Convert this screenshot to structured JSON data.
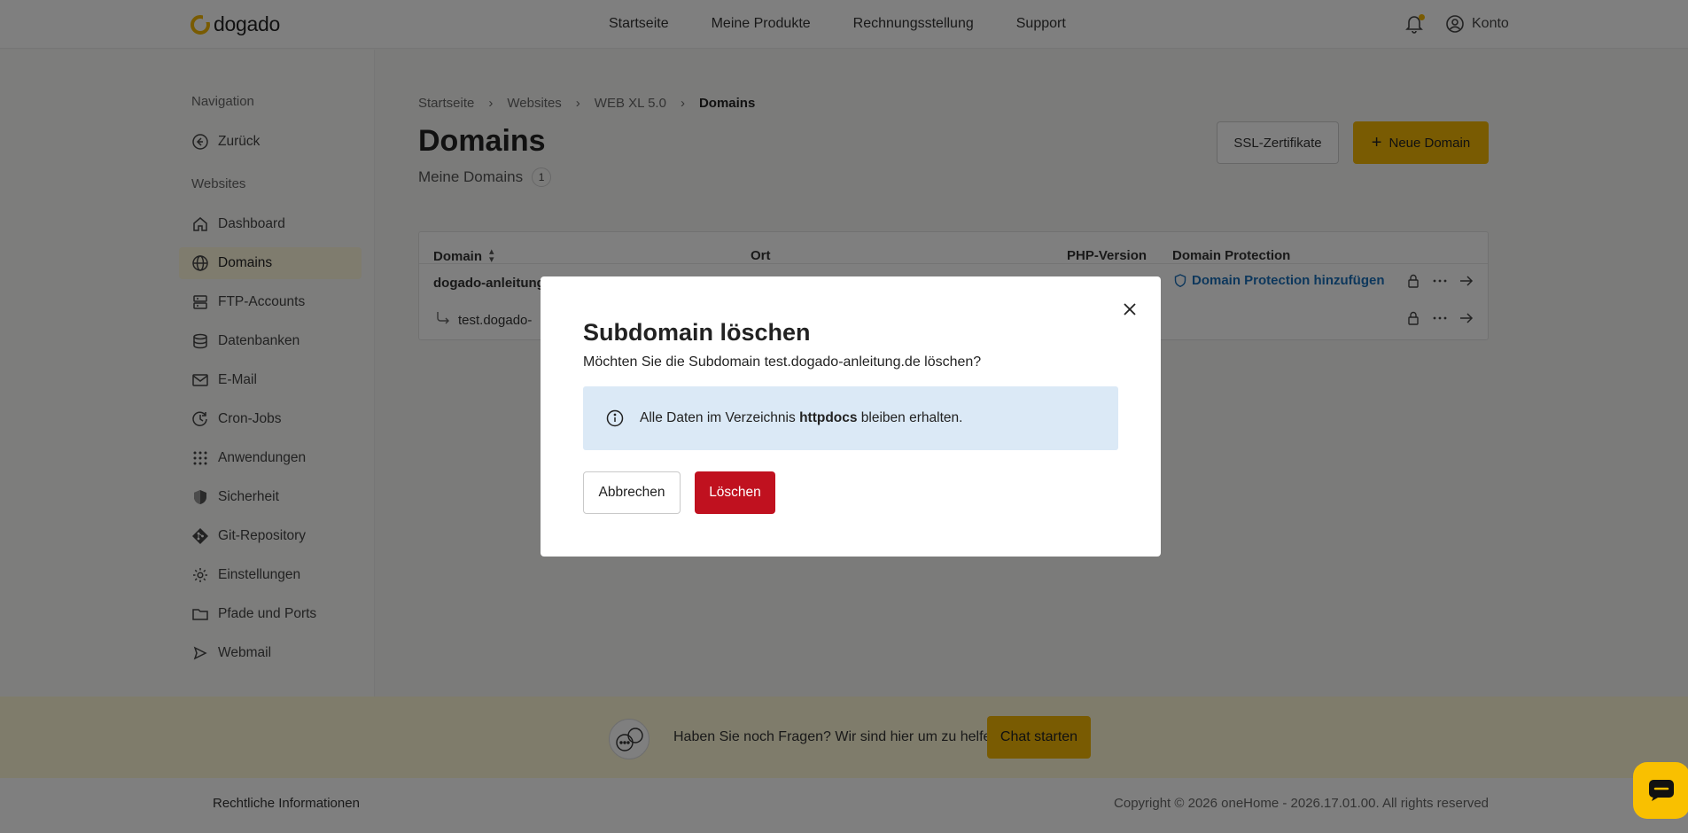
{
  "header": {
    "logo": "dogado",
    "nav": [
      "Startseite",
      "Meine Produkte",
      "Rechnungsstellung",
      "Support"
    ],
    "account_label": "Konto"
  },
  "sidebar": {
    "nav_heading": "Navigation",
    "back_label": "Zurück",
    "section_heading": "Websites",
    "items": [
      {
        "label": "Dashboard",
        "icon": "home-icon"
      },
      {
        "label": "Domains",
        "icon": "globe-icon",
        "active": true
      },
      {
        "label": "FTP-Accounts",
        "icon": "server-icon"
      },
      {
        "label": "Datenbanken",
        "icon": "database-icon"
      },
      {
        "label": "E-Mail",
        "icon": "mail-icon"
      },
      {
        "label": "Cron-Jobs",
        "icon": "clock-icon"
      },
      {
        "label": "Anwendungen",
        "icon": "grid-icon"
      },
      {
        "label": "Sicherheit",
        "icon": "shield-icon"
      },
      {
        "label": "Git-Repository",
        "icon": "git-icon"
      },
      {
        "label": "Einstellungen",
        "icon": "gear-icon"
      },
      {
        "label": "Pfade und Ports",
        "icon": "folder-icon"
      },
      {
        "label": "Webmail",
        "icon": "send-icon"
      }
    ]
  },
  "main": {
    "breadcrumb": [
      "Startseite",
      "Websites",
      "WEB XL 5.0",
      "Domains"
    ],
    "title": "Domains",
    "subtitle": "Meine Domains",
    "count": "1",
    "ssl_button": "SSL-Zertifikate",
    "new_domain_button": "Neue Domain",
    "table": {
      "columns": [
        "Domain",
        "Ort",
        "PHP-Version",
        "Domain Protection"
      ],
      "rows": [
        {
          "domain": "dogado-anleitung",
          "protection": "Domain Protection hinzufügen"
        },
        {
          "domain": "test.dogado-"
        }
      ]
    }
  },
  "help": {
    "text": "Haben Sie noch Fragen? Wir sind hier um zu helfen.",
    "chat_button": "Chat starten"
  },
  "footer": {
    "legal": "Rechtliche Informationen",
    "copyright": "Copyright © 2026 oneHome - 2026.17.01.00. All rights reserved"
  },
  "modal": {
    "title": "Subdomain löschen",
    "message": "Möchten Sie die Subdomain test.dogado-anleitung.de löschen?",
    "info_prefix": "Alle Daten im Verzeichnis ",
    "info_bold": "httpdocs",
    "info_suffix": " bleiben erhalten.",
    "cancel_button": "Abbrechen",
    "delete_button": "Löschen"
  },
  "colors": {
    "accent": "#f2b705",
    "danger": "#c0111f",
    "info_bg": "#dbe9f6",
    "link": "#1a6fb8"
  }
}
